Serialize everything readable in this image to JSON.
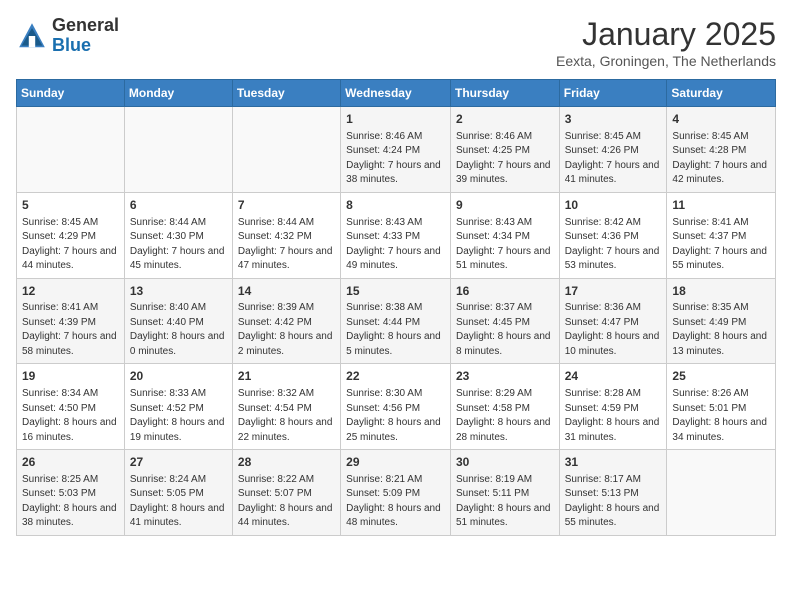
{
  "header": {
    "logo_general": "General",
    "logo_blue": "Blue",
    "month": "January 2025",
    "location": "Eexta, Groningen, The Netherlands"
  },
  "weekdays": [
    "Sunday",
    "Monday",
    "Tuesday",
    "Wednesday",
    "Thursday",
    "Friday",
    "Saturday"
  ],
  "weeks": [
    [
      {
        "day": "",
        "content": ""
      },
      {
        "day": "",
        "content": ""
      },
      {
        "day": "",
        "content": ""
      },
      {
        "day": "1",
        "content": "Sunrise: 8:46 AM\nSunset: 4:24 PM\nDaylight: 7 hours\nand 38 minutes."
      },
      {
        "day": "2",
        "content": "Sunrise: 8:46 AM\nSunset: 4:25 PM\nDaylight: 7 hours\nand 39 minutes."
      },
      {
        "day": "3",
        "content": "Sunrise: 8:45 AM\nSunset: 4:26 PM\nDaylight: 7 hours\nand 41 minutes."
      },
      {
        "day": "4",
        "content": "Sunrise: 8:45 AM\nSunset: 4:28 PM\nDaylight: 7 hours\nand 42 minutes."
      }
    ],
    [
      {
        "day": "5",
        "content": "Sunrise: 8:45 AM\nSunset: 4:29 PM\nDaylight: 7 hours\nand 44 minutes."
      },
      {
        "day": "6",
        "content": "Sunrise: 8:44 AM\nSunset: 4:30 PM\nDaylight: 7 hours\nand 45 minutes."
      },
      {
        "day": "7",
        "content": "Sunrise: 8:44 AM\nSunset: 4:32 PM\nDaylight: 7 hours\nand 47 minutes."
      },
      {
        "day": "8",
        "content": "Sunrise: 8:43 AM\nSunset: 4:33 PM\nDaylight: 7 hours\nand 49 minutes."
      },
      {
        "day": "9",
        "content": "Sunrise: 8:43 AM\nSunset: 4:34 PM\nDaylight: 7 hours\nand 51 minutes."
      },
      {
        "day": "10",
        "content": "Sunrise: 8:42 AM\nSunset: 4:36 PM\nDaylight: 7 hours\nand 53 minutes."
      },
      {
        "day": "11",
        "content": "Sunrise: 8:41 AM\nSunset: 4:37 PM\nDaylight: 7 hours\nand 55 minutes."
      }
    ],
    [
      {
        "day": "12",
        "content": "Sunrise: 8:41 AM\nSunset: 4:39 PM\nDaylight: 7 hours\nand 58 minutes."
      },
      {
        "day": "13",
        "content": "Sunrise: 8:40 AM\nSunset: 4:40 PM\nDaylight: 8 hours\nand 0 minutes."
      },
      {
        "day": "14",
        "content": "Sunrise: 8:39 AM\nSunset: 4:42 PM\nDaylight: 8 hours\nand 2 minutes."
      },
      {
        "day": "15",
        "content": "Sunrise: 8:38 AM\nSunset: 4:44 PM\nDaylight: 8 hours\nand 5 minutes."
      },
      {
        "day": "16",
        "content": "Sunrise: 8:37 AM\nSunset: 4:45 PM\nDaylight: 8 hours\nand 8 minutes."
      },
      {
        "day": "17",
        "content": "Sunrise: 8:36 AM\nSunset: 4:47 PM\nDaylight: 8 hours\nand 10 minutes."
      },
      {
        "day": "18",
        "content": "Sunrise: 8:35 AM\nSunset: 4:49 PM\nDaylight: 8 hours\nand 13 minutes."
      }
    ],
    [
      {
        "day": "19",
        "content": "Sunrise: 8:34 AM\nSunset: 4:50 PM\nDaylight: 8 hours\nand 16 minutes."
      },
      {
        "day": "20",
        "content": "Sunrise: 8:33 AM\nSunset: 4:52 PM\nDaylight: 8 hours\nand 19 minutes."
      },
      {
        "day": "21",
        "content": "Sunrise: 8:32 AM\nSunset: 4:54 PM\nDaylight: 8 hours\nand 22 minutes."
      },
      {
        "day": "22",
        "content": "Sunrise: 8:30 AM\nSunset: 4:56 PM\nDaylight: 8 hours\nand 25 minutes."
      },
      {
        "day": "23",
        "content": "Sunrise: 8:29 AM\nSunset: 4:58 PM\nDaylight: 8 hours\nand 28 minutes."
      },
      {
        "day": "24",
        "content": "Sunrise: 8:28 AM\nSunset: 4:59 PM\nDaylight: 8 hours\nand 31 minutes."
      },
      {
        "day": "25",
        "content": "Sunrise: 8:26 AM\nSunset: 5:01 PM\nDaylight: 8 hours\nand 34 minutes."
      }
    ],
    [
      {
        "day": "26",
        "content": "Sunrise: 8:25 AM\nSunset: 5:03 PM\nDaylight: 8 hours\nand 38 minutes."
      },
      {
        "day": "27",
        "content": "Sunrise: 8:24 AM\nSunset: 5:05 PM\nDaylight: 8 hours\nand 41 minutes."
      },
      {
        "day": "28",
        "content": "Sunrise: 8:22 AM\nSunset: 5:07 PM\nDaylight: 8 hours\nand 44 minutes."
      },
      {
        "day": "29",
        "content": "Sunrise: 8:21 AM\nSunset: 5:09 PM\nDaylight: 8 hours\nand 48 minutes."
      },
      {
        "day": "30",
        "content": "Sunrise: 8:19 AM\nSunset: 5:11 PM\nDaylight: 8 hours\nand 51 minutes."
      },
      {
        "day": "31",
        "content": "Sunrise: 8:17 AM\nSunset: 5:13 PM\nDaylight: 8 hours\nand 55 minutes."
      },
      {
        "day": "",
        "content": ""
      }
    ]
  ]
}
